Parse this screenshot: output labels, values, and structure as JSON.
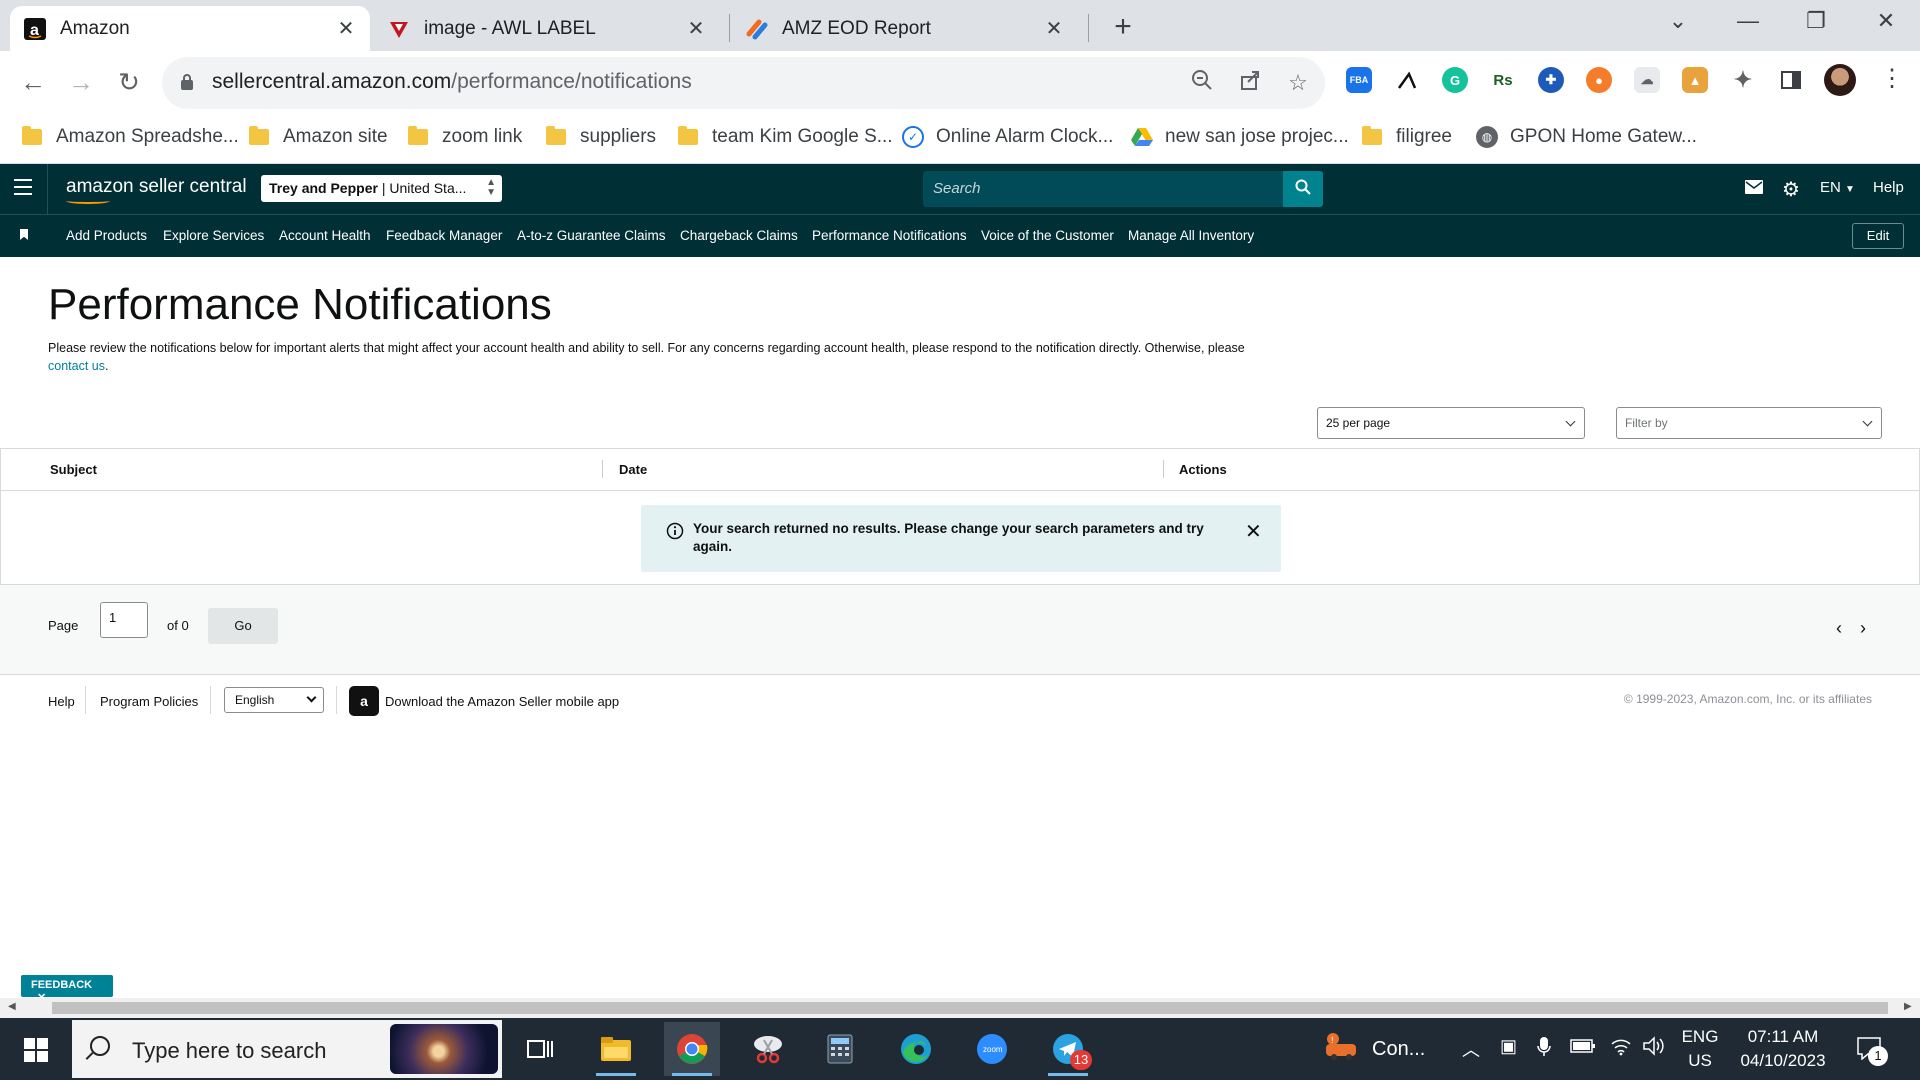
{
  "browser": {
    "tabs": [
      {
        "title": "Amazon",
        "active": true
      },
      {
        "title": "image - AWL LABEL",
        "active": false
      },
      {
        "title": "AMZ EOD Report",
        "active": false
      }
    ],
    "url_host": "sellercentral.amazon.com",
    "url_path": "/performance/notifications",
    "bookmarks": [
      {
        "label": "Amazon Spreadshe...",
        "icon": "folder-icon"
      },
      {
        "label": "Amazon site",
        "icon": "folder-icon"
      },
      {
        "label": "zoom link",
        "icon": "folder-icon"
      },
      {
        "label": "suppliers",
        "icon": "folder-icon"
      },
      {
        "label": "team Kim Google S...",
        "icon": "folder-icon"
      },
      {
        "label": "Online Alarm Clock...",
        "icon": "alarm-check-icon"
      },
      {
        "label": "new san jose projec...",
        "icon": "google-drive-icon"
      },
      {
        "label": "filigree",
        "icon": "folder-icon"
      },
      {
        "label": "GPON Home Gatew...",
        "icon": "globe-icon"
      }
    ],
    "extensions": [
      {
        "name": "fba-extension-icon",
        "label": "FBA",
        "color": "#1a73e8"
      },
      {
        "name": "helium-extension-icon",
        "label": "",
        "color": "#ffffff"
      },
      {
        "name": "grammarly-extension-icon",
        "label": "G",
        "color": "#15c39a"
      },
      {
        "name": "rs-extension-icon",
        "label": "Rs",
        "color": "#ffffff"
      },
      {
        "name": "blue-gear-extension-icon",
        "label": "",
        "color": "#1e5bb8"
      },
      {
        "name": "orange-circle-extension-icon",
        "label": "",
        "color": "#f57c2b"
      },
      {
        "name": "cloud-extension-icon",
        "label": "",
        "color": "#9aa0a6"
      },
      {
        "name": "honey-extension-icon",
        "label": "",
        "color": "#e8a33d"
      }
    ]
  },
  "seller_central": {
    "logo_text": "amazon seller central",
    "store_name": "Trey and Pepper",
    "store_region": "United Sta...",
    "search_placeholder": "Search",
    "language": "EN",
    "help": "Help",
    "nav_links": [
      "Add Products",
      "Explore Services",
      "Account Health",
      "Feedback Manager",
      "A-to-z Guarantee Claims",
      "Chargeback Claims",
      "Performance Notifications",
      "Voice of the Customer",
      "Manage All Inventory"
    ],
    "edit_label": "Edit"
  },
  "page": {
    "title": "Performance Notifications",
    "description": "Please review the notifications below for important alerts that might affect your account health and ability to sell. For any concerns regarding account health, please respond to the notification directly. Otherwise, please",
    "contact_link": "contact us",
    "contact_tail": ".",
    "per_page": "25 per page",
    "filter_placeholder": "Filter by",
    "columns": [
      "Subject",
      "Date",
      "Actions"
    ],
    "alert_message": "Your search returned no results. Please change your search parameters and try again.",
    "pager": {
      "page_label": "Page",
      "page_value": "1",
      "of_label": "of 0",
      "go_label": "Go"
    }
  },
  "footer": {
    "help": "Help",
    "program_policies": "Program Policies",
    "language": "English",
    "app_link": "Download the Amazon Seller mobile app",
    "copyright": "© 1999-2023, Amazon.com, Inc. or its affiliates"
  },
  "feedback_label": "FEEDBACK",
  "taskbar": {
    "search_placeholder": "Type here to search",
    "telegram_badge": "13",
    "tray_app_label": "Con...",
    "lang_top": "ENG",
    "lang_bottom": "US",
    "time": "07:11 AM",
    "date": "04/10/2023",
    "notification_count": "1"
  }
}
